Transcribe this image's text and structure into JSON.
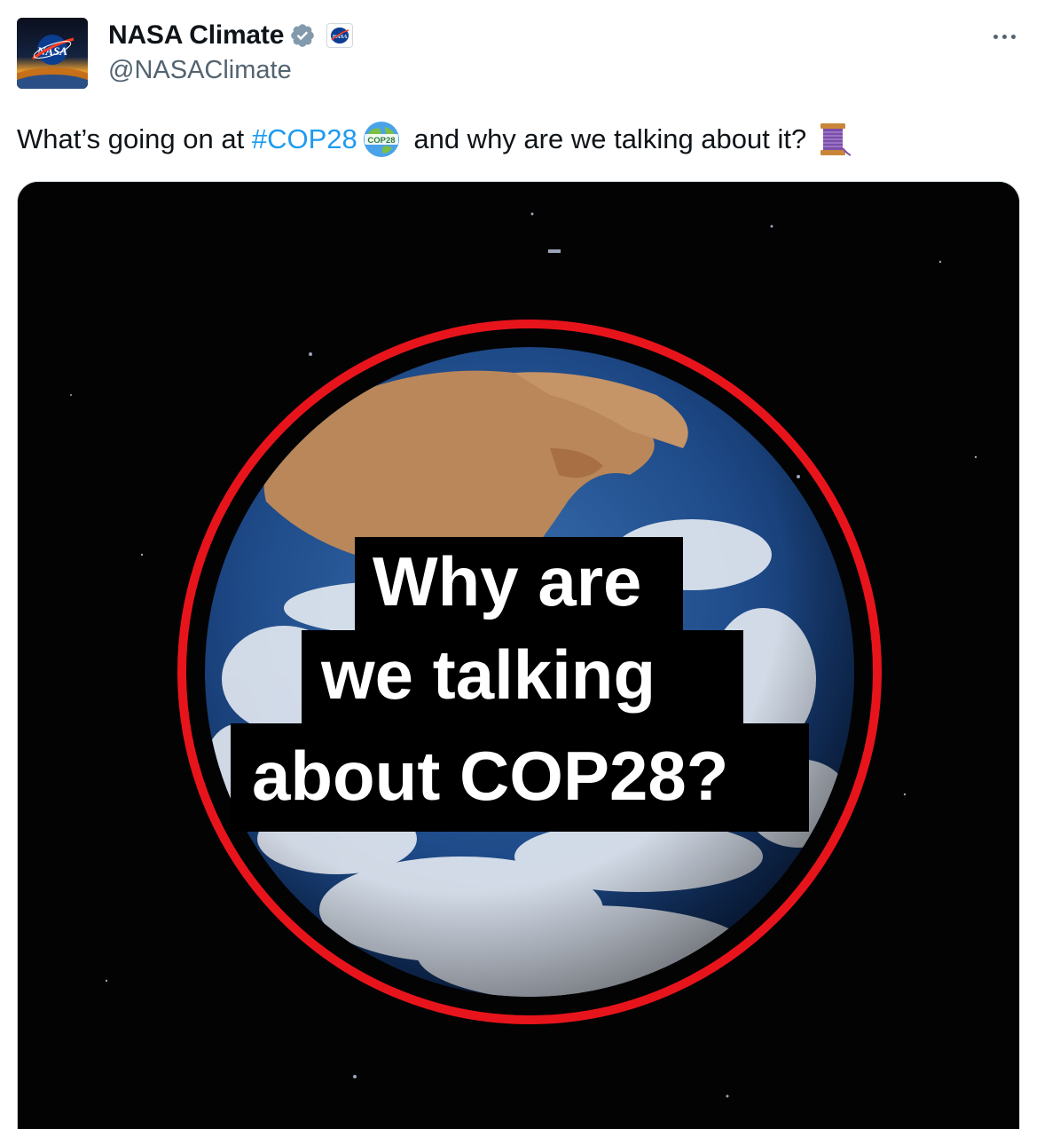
{
  "author": {
    "display_name": "NASA Climate",
    "handle": "@NASAClimate",
    "verified_icon": "verified-badge-icon",
    "affiliation_icon": "nasa-meatball-icon",
    "avatar_text": "NASA"
  },
  "menu": {
    "more_icon": "more-options-icon"
  },
  "tweet": {
    "text_before": "What’s going on at ",
    "hashtag": "#COP28",
    "globe_emoji_label": "COP28",
    "text_after": " and why are we talking about it?",
    "thread_emoji": "thread-spool-icon"
  },
  "media": {
    "caption_line_1": "Why are",
    "caption_line_2": "we talking",
    "caption_line_3": "about COP28?"
  },
  "colors": {
    "hashtag": "#1d9bf0",
    "ring": "#e8141c",
    "secondary_text": "#536471",
    "border": "#cfd9de"
  }
}
